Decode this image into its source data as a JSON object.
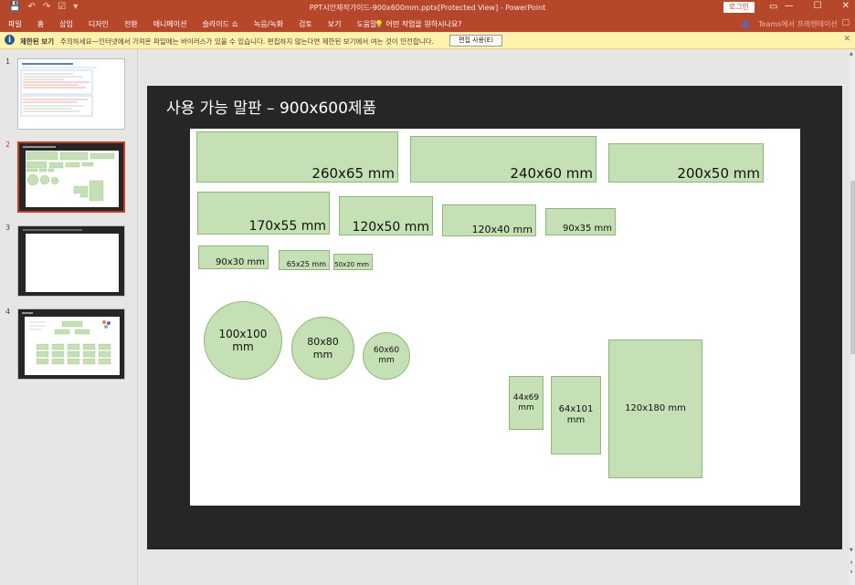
{
  "titlebar": {
    "title": "PPT시안제작가이드-900x600mm.pptx[Protected View]  -  PowerPoint",
    "login_label": "로그인",
    "qat": [
      "💾",
      "↶",
      "↷",
      "☑",
      "▾"
    ]
  },
  "ribbon": {
    "tabs": [
      "파일",
      "홈",
      "삽입",
      "디자인",
      "전환",
      "애니메이션",
      "슬라이드 쇼",
      "녹음/녹화",
      "검토",
      "보기",
      "도움말"
    ],
    "tell_me": "어떤 작업을 원하시나요?",
    "teams": "Teams에서 프레젠테이션"
  },
  "protected_bar": {
    "title": "제한된 보기",
    "message": "주의하세요—인터넷에서 가져온 파일에는 바이러스가 있을 수 있습니다. 편집하지 않는다면 제한된 보기에서 여는 것이 안전합니다.",
    "enable_button": "편집 사용(E)"
  },
  "thumbnails": [
    {
      "num": "1",
      "selected": false,
      "style": "white"
    },
    {
      "num": "2",
      "selected": true,
      "style": "dark"
    },
    {
      "num": "3",
      "selected": false,
      "style": "dark"
    },
    {
      "num": "4",
      "selected": false,
      "style": "dark"
    }
  ],
  "slide": {
    "title": "사용 가능 말판 – 900x600제품",
    "boards": [
      {
        "label": "260x65 mm",
        "shape": "rect"
      },
      {
        "label": "240x60 mm",
        "shape": "rect"
      },
      {
        "label": "200x50 mm",
        "shape": "rect"
      },
      {
        "label": "170x55 mm",
        "shape": "rect"
      },
      {
        "label": "120x50 mm",
        "shape": "rect"
      },
      {
        "label": "120x40 mm",
        "shape": "rect"
      },
      {
        "label": "90x35 mm",
        "shape": "rect"
      },
      {
        "label": "90x30 mm",
        "shape": "rect"
      },
      {
        "label": "65x25 mm",
        "shape": "rect"
      },
      {
        "label": "50x20 mm",
        "shape": "rect"
      },
      {
        "label": "100x100\nmm",
        "shape": "circle"
      },
      {
        "label": "80x80\nmm",
        "shape": "circle"
      },
      {
        "label": "60x60\nmm",
        "shape": "circle"
      },
      {
        "label": "44x69\nmm",
        "shape": "rect"
      },
      {
        "label": "64x101\nmm",
        "shape": "rect"
      },
      {
        "label": "120x180 mm",
        "shape": "rect"
      }
    ]
  },
  "colors": {
    "accent": "#b7472a",
    "board_fill": "#c5e0b4",
    "slide_bg": "#262626",
    "warning_bar": "#fff2ab"
  }
}
